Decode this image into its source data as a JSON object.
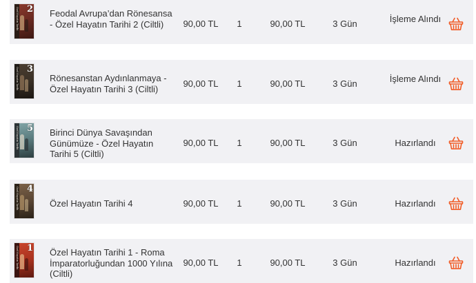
{
  "orders": [
    {
      "title": "Feodal Avrupa’dan Rönesansa - Özel Hayatın Tarihi 2 (Ciltli)",
      "price": "90,00 TL",
      "quantity": "1",
      "total": "90,00 TL",
      "shipping": "3 Gün",
      "status": "İşleme Alındı",
      "cover": {
        "volume": "2",
        "spine_text": "Özel Hayatın Tarihi",
        "spine_color": "#2a1c16",
        "art_color": "#6b2a22",
        "accent": "#c9a77b"
      }
    },
    {
      "title": "Rönesanstan Aydınlanmaya - Özel Hayatın Tarihi 3 (Ciltli)",
      "price": "90,00 TL",
      "quantity": "1",
      "total": "90,00 TL",
      "shipping": "3 Gün",
      "status": "İşleme Alındı",
      "cover": {
        "volume": "3",
        "spine_text": "Özel Hayatın Tarihi",
        "spine_color": "#1e1a16",
        "art_color": "#3a3026",
        "accent": "#8a6e52"
      }
    },
    {
      "title": "Birinci Dünya Savaşından Günümüze - Özel Hayatın Tarihi 5 (Ciltli)",
      "price": "90,00 TL",
      "quantity": "1",
      "total": "90,00 TL",
      "shipping": "3 Gün",
      "status": "Hazırlandı",
      "cover": {
        "volume": "5",
        "spine_text": "Özel Hayatın Tarihi",
        "spine_color": "#2c3336",
        "art_color": "#5c7d80",
        "accent": "#d7d2c3"
      }
    },
    {
      "title": "Özel Hayatın Tarihi 4",
      "price": "90,00 TL",
      "quantity": "1",
      "total": "90,00 TL",
      "shipping": "3 Gün",
      "status": "Hazırlandı",
      "cover": {
        "volume": "4",
        "spine_text": "Özel Hayatın Tarihi",
        "spine_color": "#2b2218",
        "art_color": "#5a4634",
        "accent": "#a98b62"
      }
    },
    {
      "title": "Özel Hayatın Tarihi 1 - Roma İmparatorluğundan 1000 Yılına (Ciltli)",
      "price": "90,00 TL",
      "quantity": "1",
      "total": "90,00 TL",
      "shipping": "3 Gün",
      "status": "Hazırlandı",
      "cover": {
        "volume": "1",
        "spine_text": "Özel Hayatın Tarihi",
        "spine_color": "#3a1410",
        "art_color": "#a8321f",
        "accent": "#e2b184"
      }
    }
  ],
  "icons": {
    "reorder": "basket-icon"
  },
  "colors": {
    "row_background": "#f1f1f4",
    "text": "#333333",
    "basket": "#f15a24"
  }
}
